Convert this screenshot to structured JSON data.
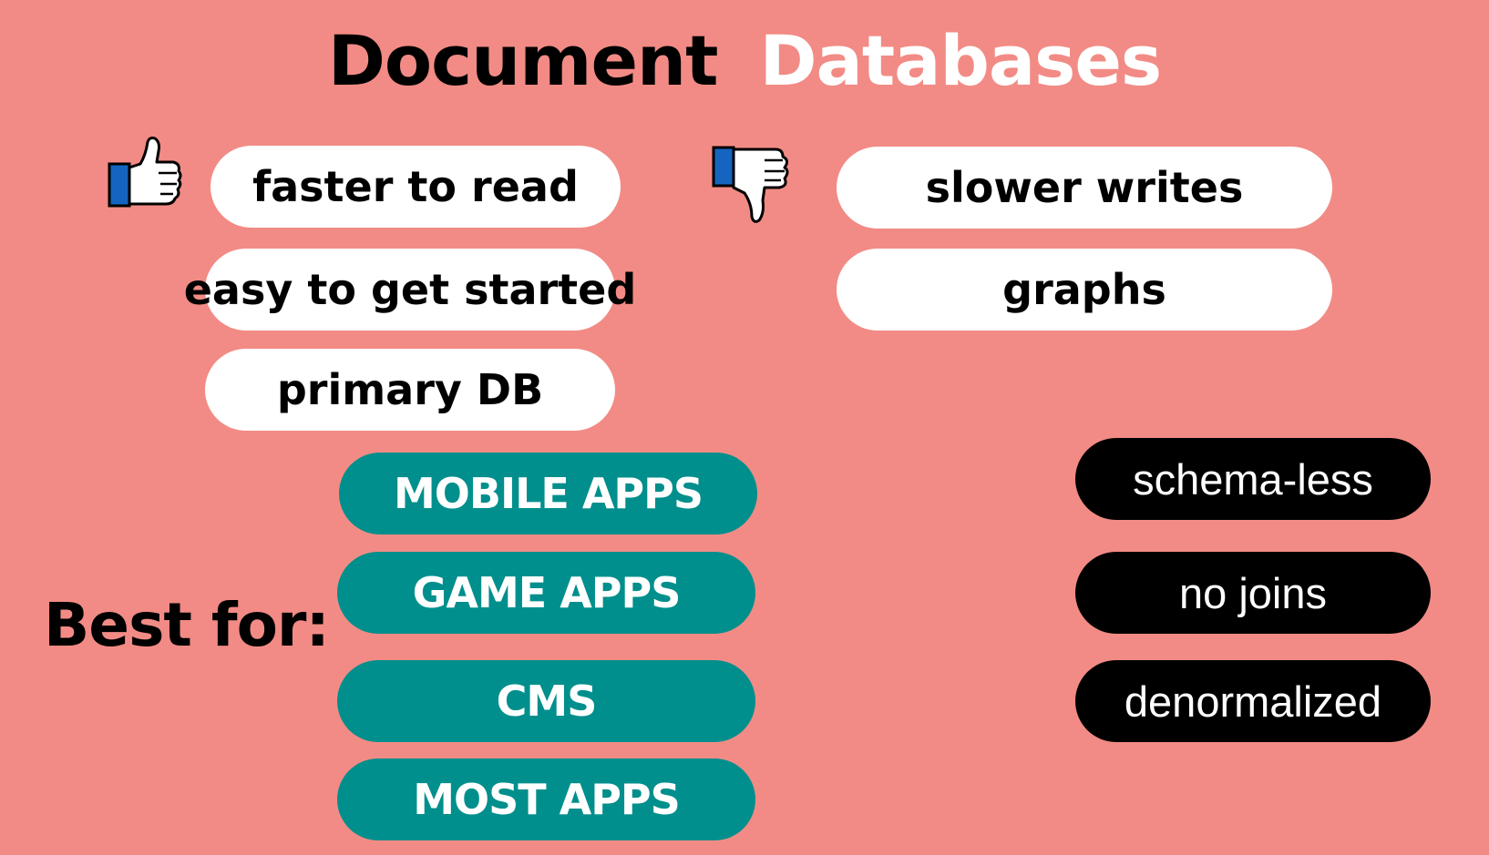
{
  "title": {
    "word1": "Document",
    "word2": "Databases"
  },
  "pros": {
    "icon": "thumbs-up-icon",
    "items": [
      "faster to read",
      "easy to get started",
      "primary DB"
    ]
  },
  "cons": {
    "icon": "thumbs-down-icon",
    "items": [
      "slower writes",
      "graphs"
    ]
  },
  "best_for": {
    "label": "Best for:",
    "items": [
      "MOBILE APPS",
      "GAME APPS",
      "CMS",
      "MOST APPS"
    ]
  },
  "traits": [
    "schema-less",
    "no joins",
    "denormalized"
  ],
  "colors": {
    "background": "#f28b85",
    "pill_white": "#ffffff",
    "pill_teal": "#008f8c",
    "pill_black": "#000000",
    "thumb_cuff": "#1565c0"
  }
}
